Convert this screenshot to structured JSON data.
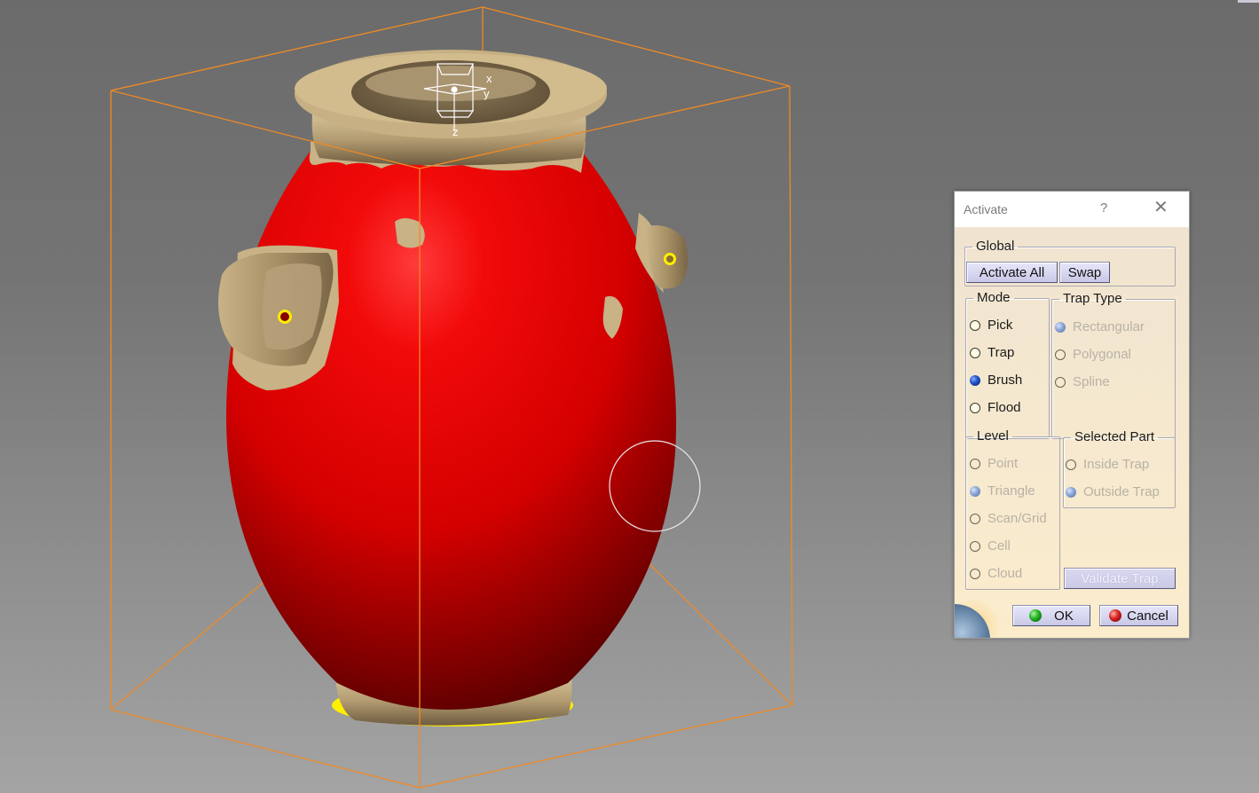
{
  "viewport": {
    "model": "vase-mesh",
    "activated_color": "#e00000",
    "deactivated_color": "#b8a27a",
    "bounding_box_color": "#f08a24",
    "boundary_highlight_color": "#ffee00",
    "axis_labels": {
      "x": "x",
      "y": "y",
      "z": "z"
    },
    "brush_cursor": "circle"
  },
  "dialog": {
    "title": "Activate",
    "help_label": "?",
    "close_label": "✕",
    "global": {
      "legend": "Global",
      "activate_all_label": "Activate All",
      "swap_label": "Swap"
    },
    "mode": {
      "legend": "Mode",
      "options": [
        {
          "label": "Pick",
          "selected": false
        },
        {
          "label": "Trap",
          "selected": false
        },
        {
          "label": "Brush",
          "selected": true
        },
        {
          "label": "Flood",
          "selected": false
        }
      ]
    },
    "trap_type": {
      "legend": "Trap Type",
      "enabled": false,
      "options": [
        {
          "label": "Rectangular",
          "selected": true
        },
        {
          "label": "Polygonal",
          "selected": false
        },
        {
          "label": "Spline",
          "selected": false
        }
      ]
    },
    "level": {
      "legend": "Level",
      "enabled": false,
      "options": [
        {
          "label": "Point",
          "selected": false
        },
        {
          "label": "Triangle",
          "selected": true
        },
        {
          "label": "Scan/Grid",
          "selected": false
        },
        {
          "label": "Cell",
          "selected": false
        },
        {
          "label": "Cloud",
          "selected": false
        }
      ]
    },
    "selected_part": {
      "legend": "Selected Part",
      "enabled": false,
      "options": [
        {
          "label": "Inside Trap",
          "selected": false
        },
        {
          "label": "Outside Trap",
          "selected": true
        }
      ]
    },
    "validate_trap_label": "Validate Trap",
    "ok_label": "OK",
    "cancel_label": "Cancel"
  }
}
